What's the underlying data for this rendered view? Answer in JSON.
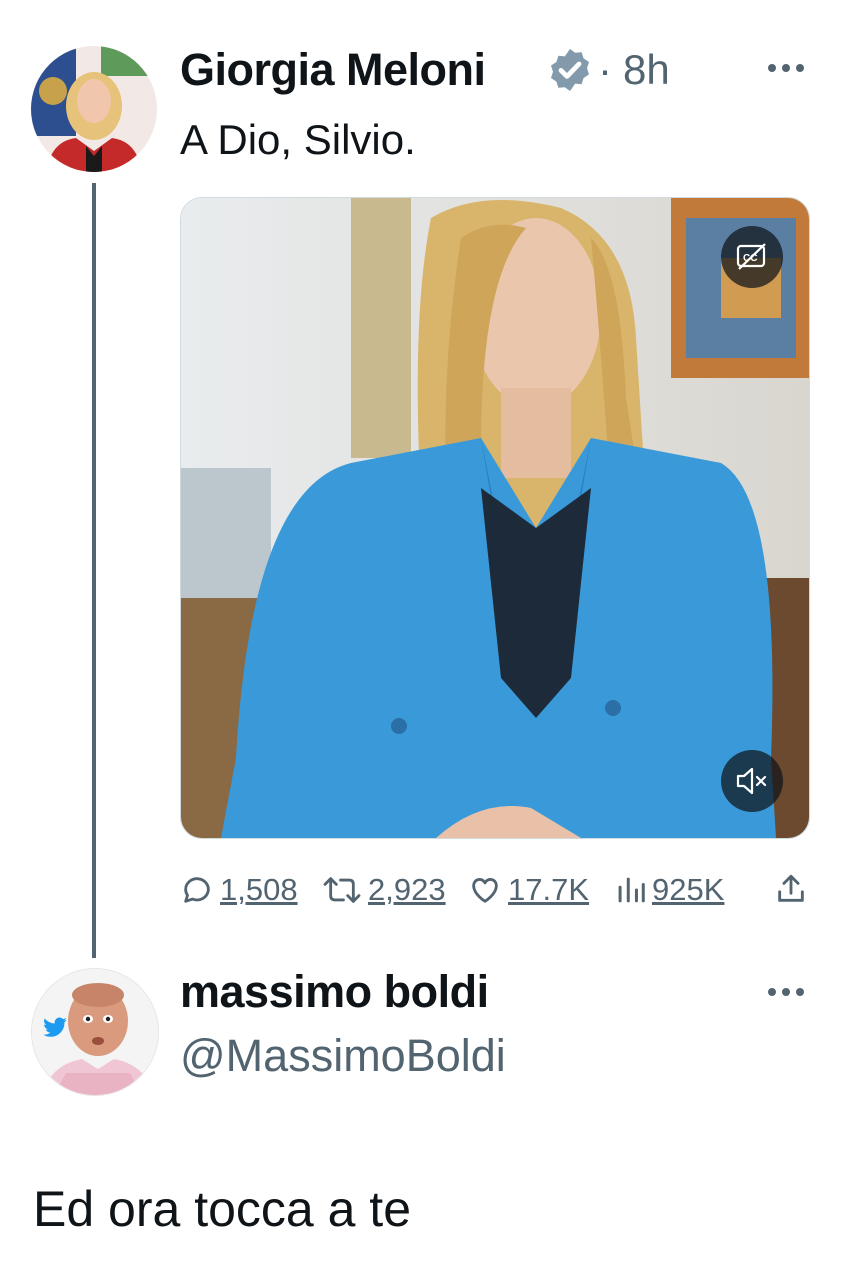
{
  "tweet": {
    "author_name": "Giorgia Meloni",
    "separator": "·",
    "time": "8h",
    "text": "A Dio, Silvio.",
    "verified_icon": "verified-badge-icon",
    "media_controls": {
      "captions_icon": "captions-off-icon",
      "mute_icon": "muted-speaker-icon"
    },
    "stats": {
      "replies": "1,508",
      "reposts": "2,923",
      "likes": "17.7K",
      "views": "925K"
    }
  },
  "reply": {
    "author_name": "massimo boldi",
    "handle": "@MassimoBoldi",
    "text": "Ed ora tocca a te"
  },
  "colors": {
    "text": "#0f1419",
    "muted": "#536471",
    "verified": "#829aab",
    "blazer": "#3a9ad9",
    "twitter_blue": "#1d9bf0"
  }
}
